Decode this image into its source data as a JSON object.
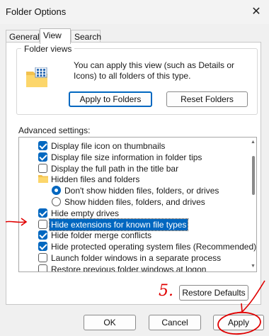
{
  "window": {
    "title": "Folder Options",
    "close_glyph": "✕"
  },
  "tabs": [
    {
      "label": "General",
      "active": false
    },
    {
      "label": "View",
      "active": true
    },
    {
      "label": "Search",
      "active": false
    }
  ],
  "folder_views": {
    "label": "Folder views",
    "description": "You can apply this view (such as Details or Icons) to all folders of this type.",
    "apply_button": "Apply to Folders",
    "reset_button": "Reset Folders",
    "icon": "folder-grid-icon"
  },
  "advanced": {
    "label": "Advanced settings:",
    "items": [
      {
        "kind": "checkbox",
        "label": "Display file icon on thumbnails",
        "checked": true,
        "indent": 1
      },
      {
        "kind": "checkbox",
        "label": "Display file size information in folder tips",
        "checked": true,
        "indent": 1
      },
      {
        "kind": "checkbox",
        "label": "Display the full path in the title bar",
        "checked": false,
        "indent": 1
      },
      {
        "kind": "folder",
        "label": "Hidden files and folders",
        "indent": 1
      },
      {
        "kind": "radio",
        "label": "Don't show hidden files, folders, or drives",
        "selected": true,
        "indent": 2
      },
      {
        "kind": "radio",
        "label": "Show hidden files, folders, and drives",
        "selected": false,
        "indent": 2
      },
      {
        "kind": "checkbox",
        "label": "Hide empty drives",
        "checked": true,
        "indent": 1
      },
      {
        "kind": "checkbox",
        "label": "Hide extensions for known file types",
        "checked": false,
        "indent": 1,
        "highlighted": true
      },
      {
        "kind": "checkbox",
        "label": "Hide folder merge conflicts",
        "checked": true,
        "indent": 1
      },
      {
        "kind": "checkbox",
        "label": "Hide protected operating system files (Recommended)",
        "checked": true,
        "indent": 1
      },
      {
        "kind": "checkbox",
        "label": "Launch folder windows in a separate process",
        "checked": false,
        "indent": 1
      },
      {
        "kind": "checkbox",
        "label": "Restore previous folder windows at logon",
        "checked": false,
        "indent": 1
      }
    ]
  },
  "restore_defaults": "Restore Defaults",
  "footer": {
    "ok": "OK",
    "cancel": "Cancel",
    "apply": "Apply"
  },
  "annotations": {
    "step_label": "5.",
    "color": "#e00000"
  },
  "colors": {
    "accent": "#0067c0",
    "annotation": "#e00000"
  }
}
